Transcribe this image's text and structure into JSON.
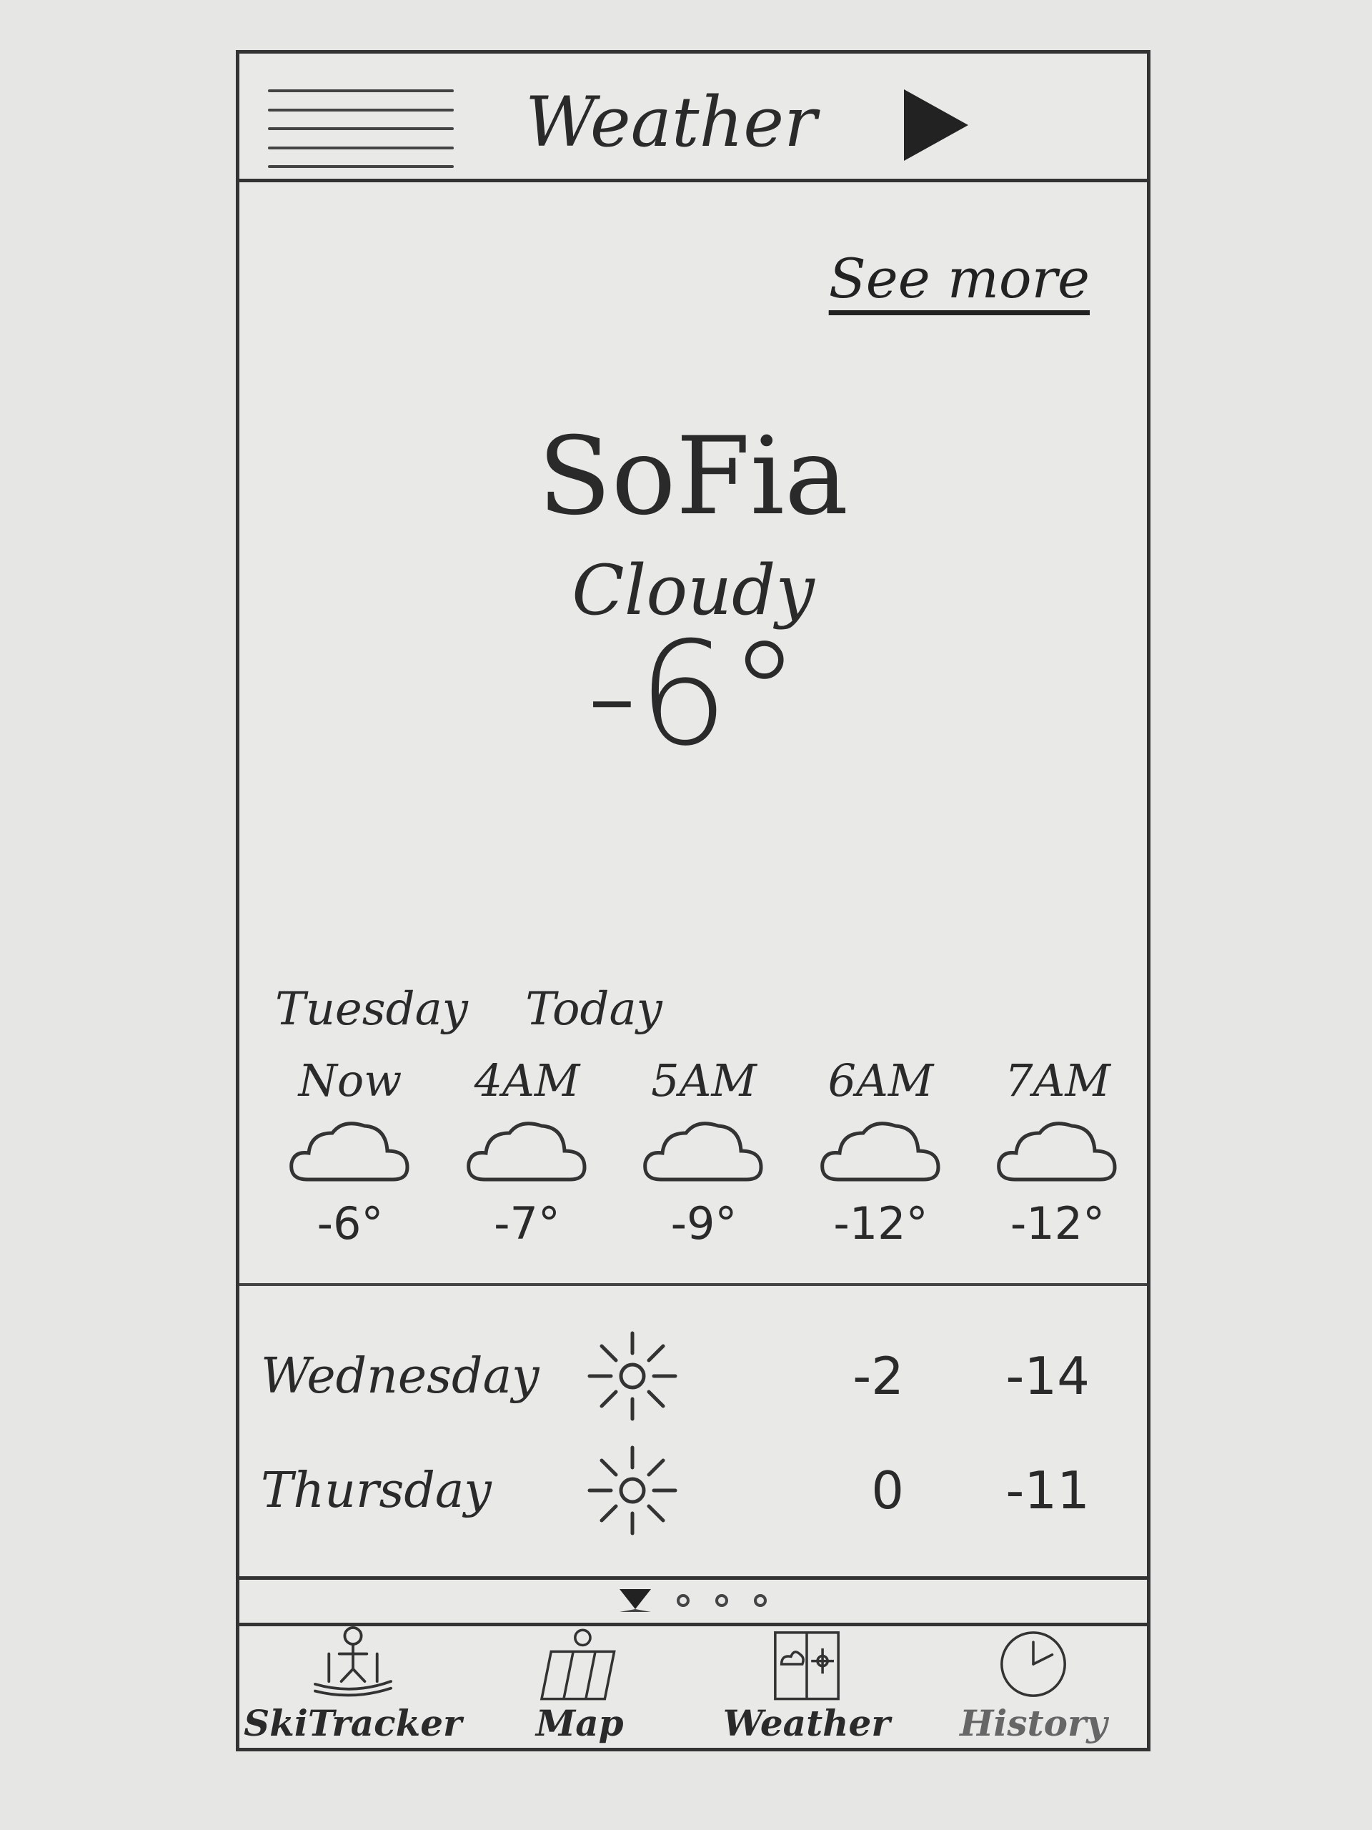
{
  "header": {
    "title": "Weather"
  },
  "see_more_label": "See more",
  "current": {
    "city": "SoFia",
    "condition": "Cloudy",
    "temperature": "-6°"
  },
  "day_labels": [
    "Tuesday",
    "Today"
  ],
  "hourly": [
    {
      "time": "Now",
      "icon": "cloud-icon",
      "temp": "-6°"
    },
    {
      "time": "4AM",
      "icon": "cloud-icon",
      "temp": "-7°"
    },
    {
      "time": "5AM",
      "icon": "cloud-icon",
      "temp": "-9°"
    },
    {
      "time": "6AM",
      "icon": "cloud-icon",
      "temp": "-12°"
    },
    {
      "time": "7AM",
      "icon": "cloud-icon",
      "temp": "-12°"
    }
  ],
  "daily": [
    {
      "day": "Wednesday",
      "icon": "sun-icon",
      "high": "-2",
      "low": "-14"
    },
    {
      "day": "Thursday",
      "icon": "sun-icon",
      "high": "0",
      "low": "-11"
    }
  ],
  "pagination": {
    "pages": 4,
    "active": 1
  },
  "tabbar": [
    {
      "label": "SkiTracker",
      "icon": "skier-icon"
    },
    {
      "label": "Map",
      "icon": "map-icon"
    },
    {
      "label": "Weather",
      "icon": "weather-icon"
    },
    {
      "label": "History",
      "icon": "clock-icon"
    }
  ]
}
